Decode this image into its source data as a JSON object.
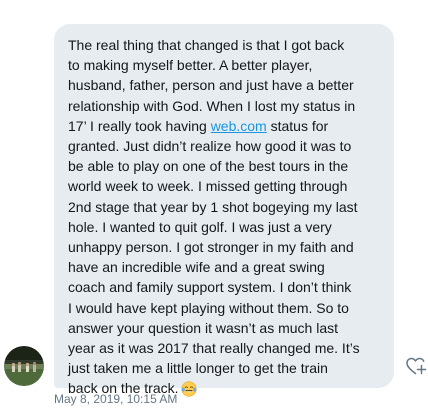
{
  "message": {
    "lines": [
      "The real thing that changed is that I got back",
      "to making myself better. A better player,",
      "husband, father, person and just have a better",
      "relationship with God. When I lost my status in"
    ],
    "link_line_before": "17’ I really took having ",
    "link_text": "web.com",
    "link_line_after": " status for",
    "lines_after": [
      "granted. Just didn’t realize how good it was to",
      "be able to play on one of the best tours in the",
      "world week to week. I missed getting through",
      "2nd stage that year by 1 shot bogeying my last",
      "hole. I wanted to quit golf. I was just a very",
      "unhappy person. I got stronger in my faith and",
      "have an incredible wife and a great swing",
      "coach and family support system. I don’t think",
      "I would have kept playing without them.  So to",
      "answer your question it wasn’t as much last",
      "year as it was 2017 that really changed me. It’s",
      "just taken me a little longer to get the train"
    ],
    "last_line": "back on the track.",
    "emoji_icon": "face-with-tears-of-joy-icon"
  },
  "timestamp": "May 8, 2019, 10:15 AM",
  "avatar_icon": "user-avatar",
  "react_icon": "heart-plus-icon",
  "colors": {
    "bubble_bg": "#e6ecf0",
    "text": "#14171a",
    "link": "#1b95e0",
    "timestamp": "#657786",
    "icon": "#657786"
  }
}
